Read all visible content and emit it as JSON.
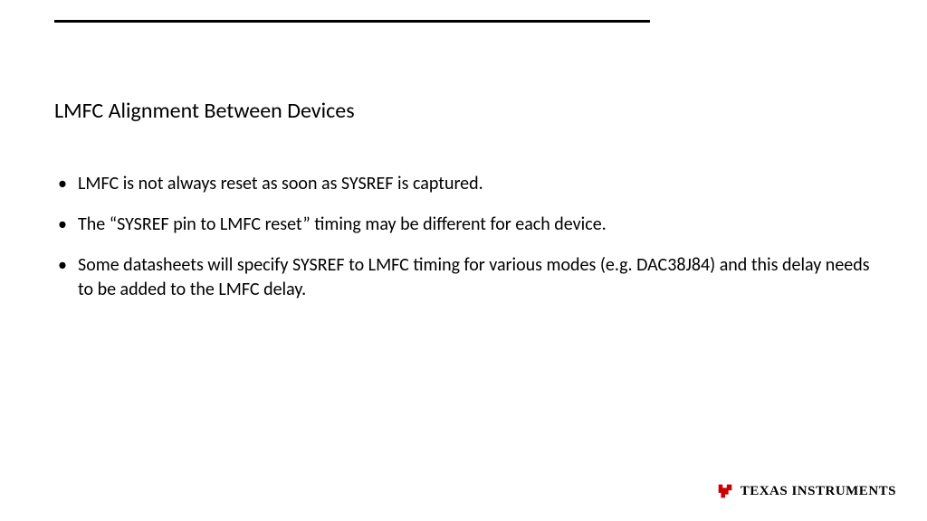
{
  "title": "LMFC Alignment Between Devices",
  "bullets": [
    "LMFC is not always reset as soon as SYSREF is captured.",
    "The “SYSREF pin to LMFC reset” timing may be different for each device.",
    "Some datasheets will specify SYSREF to LMFC timing for various modes (e.g. DAC38J84) and this delay needs to be added to the LMFC delay."
  ],
  "footer": {
    "company": "TEXAS INSTRUMENTS",
    "logo_color": "#cc0000"
  }
}
